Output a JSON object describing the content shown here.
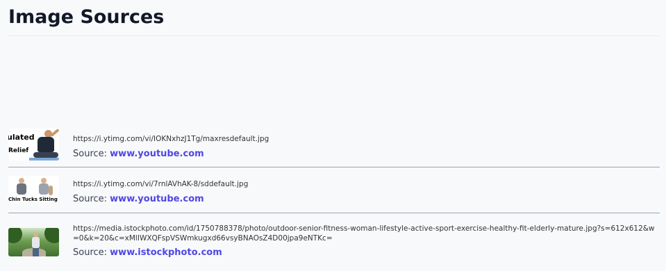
{
  "header": {
    "title": "Image Sources"
  },
  "sources": [
    {
      "thumbnail_icon": "thumbnail-image",
      "thumbnail_text": [
        "ulated",
        "Relief"
      ],
      "url": "https://i.ytimg.com/vi/IOKNxhzJ1Tg/maxresdefault.jpg",
      "source_label": "Source:",
      "source_name": "www.youtube.com"
    },
    {
      "thumbnail_icon": "thumbnail-image",
      "thumbnail_text": [
        "Chin Tucks Sitting"
      ],
      "url": "https://i.ytimg.com/vi/7rnlAVhAK-8/sddefault.jpg",
      "source_label": "Source:",
      "source_name": "www.youtube.com"
    },
    {
      "thumbnail_icon": "thumbnail-image",
      "thumbnail_text": [],
      "url": "https://media.istockphoto.com/id/1750788378/photo/outdoor-senior-fitness-woman-lifestyle-active-sport-exercise-healthy-fit-elderly-mature.jpg?s=612x612&w=0&k=20&c=xMlIWXQFspVSWmkugxd66vsyBNAOsZ4D00jpa9eNTKc=",
      "source_label": "Source:",
      "source_name": "www.istockphoto.com"
    }
  ],
  "colors": {
    "link": "#4f46e5",
    "background": "#f8f9fb",
    "divider": "#9ca3af"
  }
}
